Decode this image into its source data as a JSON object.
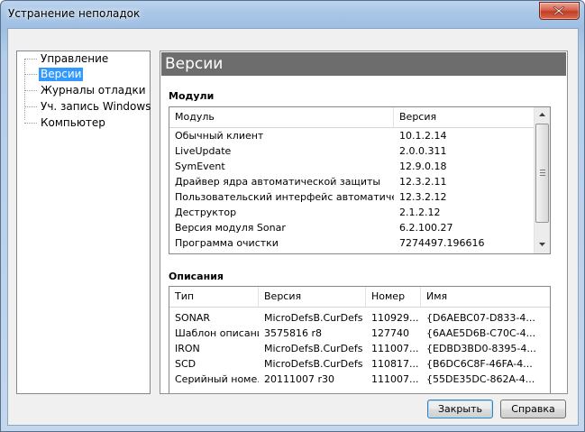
{
  "window": {
    "title": "Устранение неполадок"
  },
  "tree": {
    "items": [
      {
        "label": "Управление",
        "selected": false
      },
      {
        "label": "Версии",
        "selected": true
      },
      {
        "label": "Журналы отладки",
        "selected": false
      },
      {
        "label": "Уч. запись Windows",
        "selected": false
      },
      {
        "label": "Компьютер",
        "selected": false
      }
    ]
  },
  "content": {
    "header": "Версии",
    "modules": {
      "title": "Модули",
      "columns": [
        "Модуль",
        "Версия"
      ],
      "rows": [
        [
          "Обычный клиент",
          "10.1.2.14"
        ],
        [
          "LiveUpdate",
          "2.0.0.311"
        ],
        [
          "SymEvent",
          "12.9.0.18"
        ],
        [
          "Драйвер ядра автоматической защиты",
          "12.3.2.11"
        ],
        [
          "Пользовательский интерфейс автоматическ...",
          "12.3.2.12"
        ],
        [
          "Деструктор",
          "2.1.2.12"
        ],
        [
          "Версия модуля Sonar",
          "6.2.100.27"
        ],
        [
          "Программа очистки",
          "7274497.196616"
        ]
      ]
    },
    "definitions": {
      "title": "Описания",
      "columns": [
        "Тип",
        "Версия",
        "Номер",
        "Имя"
      ],
      "rows": [
        [
          "SONAR",
          "MicroDefsB.CurDefs",
          "110929...",
          "{D6AEBC07-D833-4..."
        ],
        [
          "Шаблон описаний",
          "3575816 r8",
          "127740",
          "{6AAE5D6B-C70C-4..."
        ],
        [
          "IRON",
          "MicroDefsB.CurDefs",
          "111007...",
          "{EDBD3BD0-8395-4..."
        ],
        [
          "SCD",
          "MicroDefsB.CurDefs",
          "110817...",
          "{B6DC6C8F-46FA-4..."
        ],
        [
          "Серийный номе...",
          "20111007 r30",
          "111007...",
          "{55DE35DC-862A-4..."
        ]
      ]
    }
  },
  "buttons": {
    "close": "Закрыть",
    "help": "Справка"
  },
  "colors": {
    "selection": "#3399ff",
    "header_bar": "#6d6d6d",
    "close_button": "#c13d22"
  }
}
